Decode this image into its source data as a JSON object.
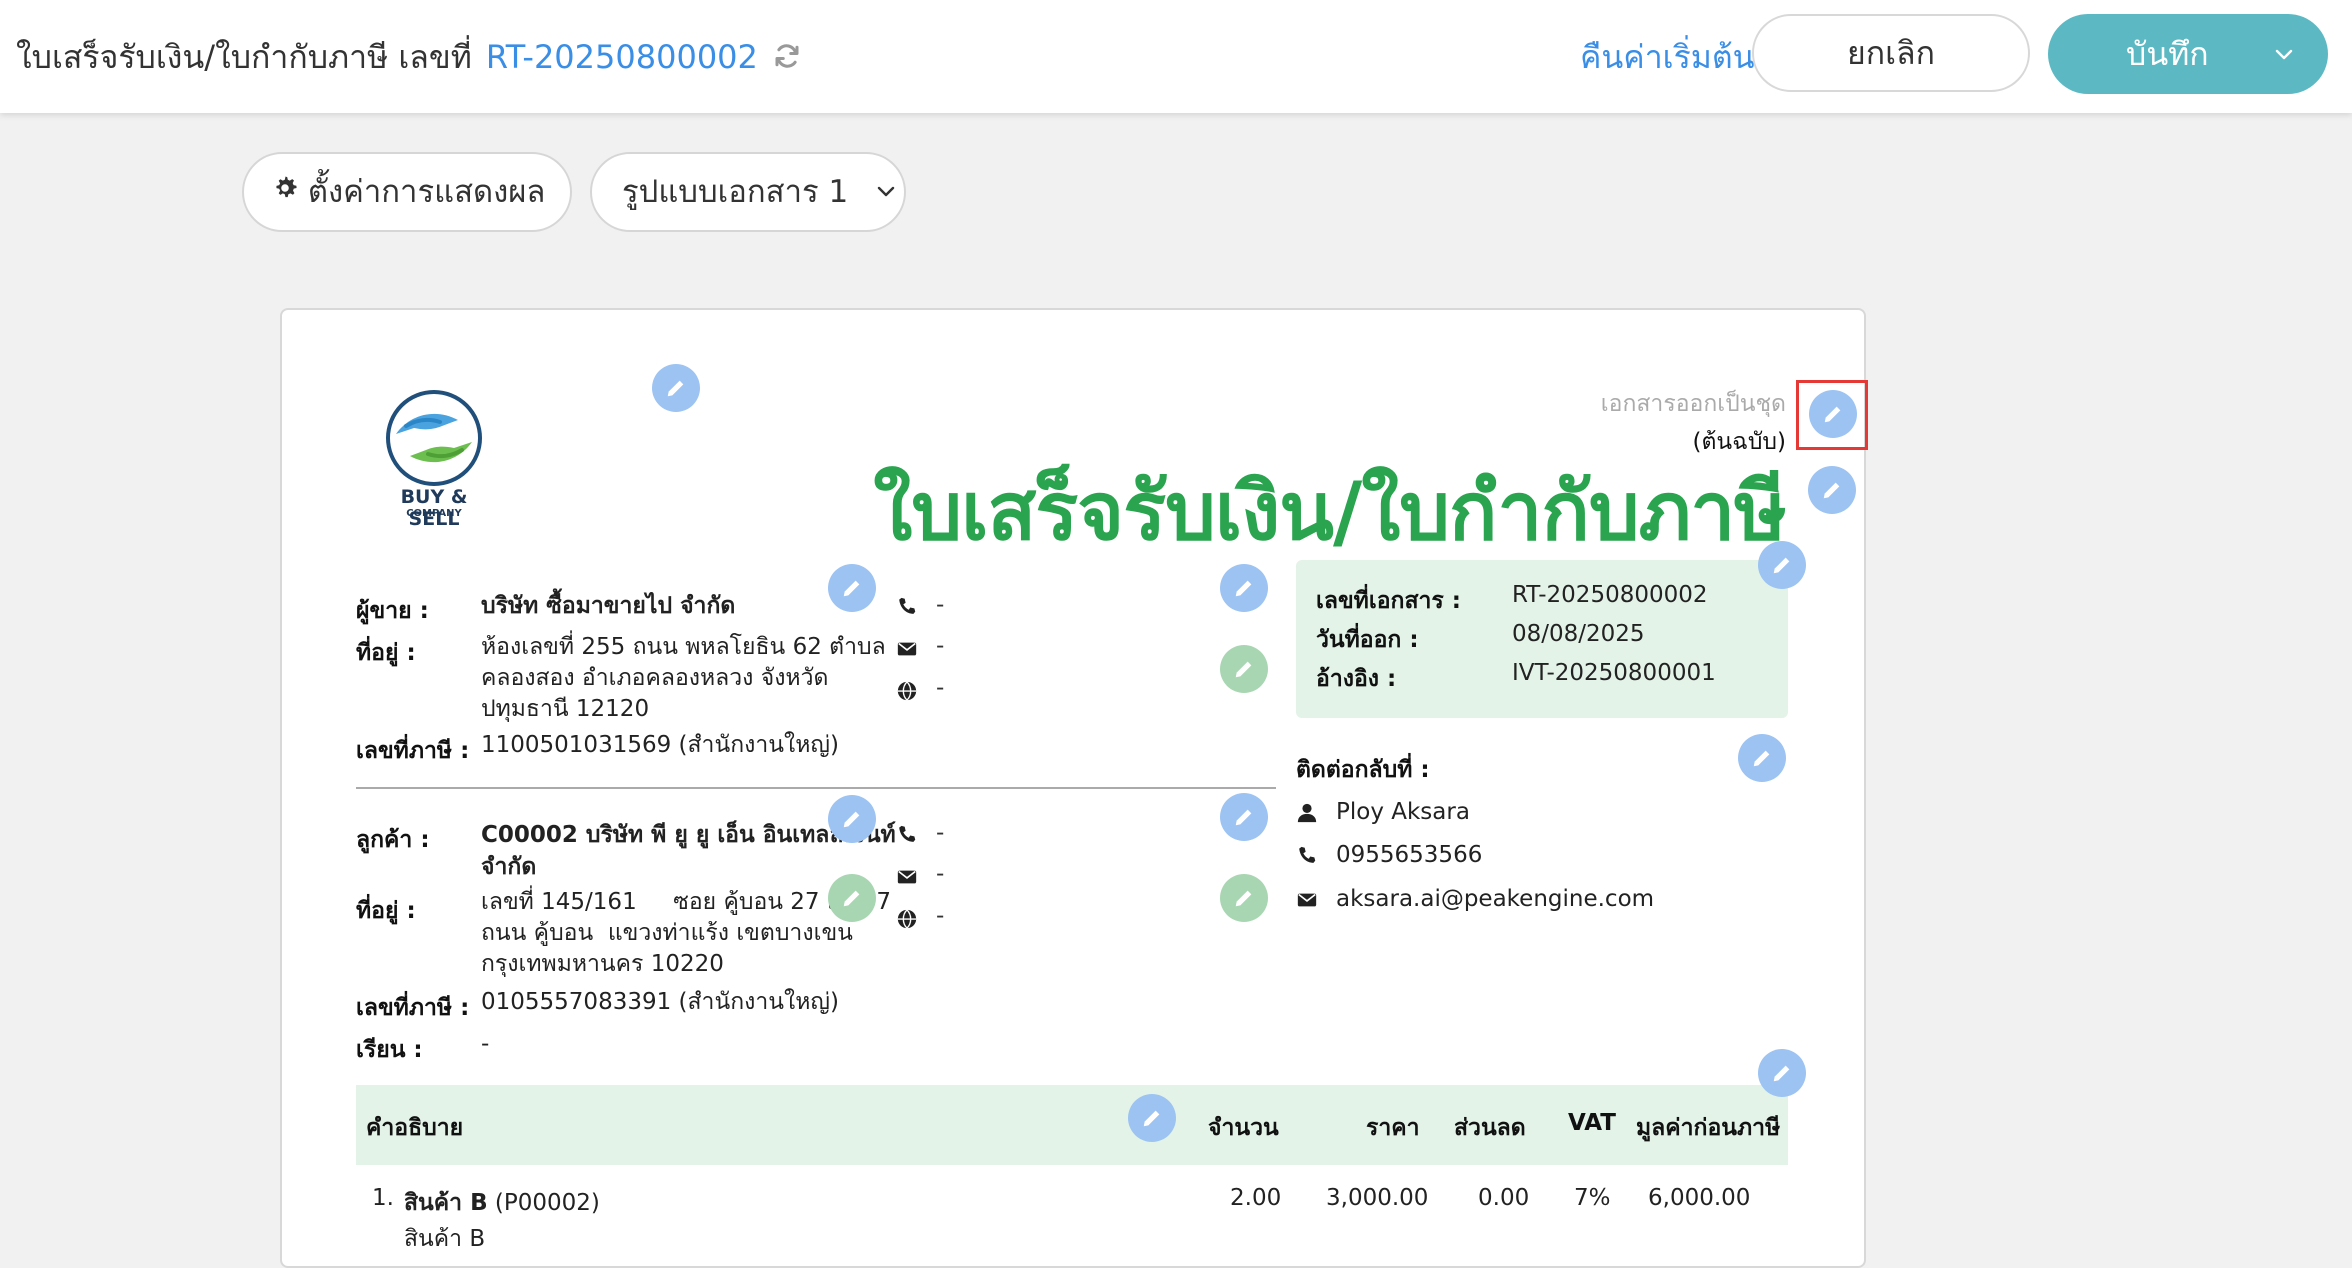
{
  "header": {
    "title": "ใบเสร็จรับเงิน/ใบกำกับภาษี เลขที่",
    "doc_no": "RT-20250800002",
    "reset_label": "คืนค่าเริ่มต้น",
    "cancel_label": "ยกเลิก",
    "save_label": "บันทึก"
  },
  "toolbar": {
    "settings_label": "ตั้งค่าการแสดงผล",
    "format_label": "รูปแบบเอกสาร 1"
  },
  "document": {
    "logo_text": "BUY & SELL",
    "logo_sub": "COMPANY",
    "copy_note": "เอกสารออกเป็นชุด",
    "copy_type": "(ต้นฉบับ)",
    "title": "ใบเสร็จรับเงิน/ใบกำกับภาษี",
    "seller": {
      "label": "ผู้ขาย :",
      "name": "บริษัท ซื้อมาขายไป จำกัด",
      "address_label": "ที่อยู่ :",
      "address_lines": [
        "ห้องเลขที่ 255 ถนน พหลโยธิน 62 ตำบล",
        "คลองสอง อำเภอคลองหลวง จังหวัด",
        "ปทุมธานี 12120"
      ],
      "tax_label": "เลขที่ภาษี :",
      "tax_id": "1100501031569 (สำนักงานใหญ่)",
      "phone": "-",
      "email": "-",
      "web": "-"
    },
    "customer": {
      "label": "ลูกค้า :",
      "name_lines": [
        "C00002 บริษัท พี ยู ยู เอ็น อินเทลลิเจนท์",
        "จำกัด"
      ],
      "address_label": "ที่อยู่ :",
      "address_lines": [
        "เลขที่ 145/161     ซอย คู้บอน 27 แยก 7",
        "ถนน คู้บอน  แขวงท่าแร้ง เขตบางเขน",
        "กรุงเทพมหานคร 10220"
      ],
      "tax_label": "เลขที่ภาษี :",
      "tax_id": "0105557083391 (สำนักงานใหญ่)",
      "attn_label": "เรียน :",
      "attn": "-",
      "phone": "-",
      "email": "-",
      "web": "-"
    },
    "info": {
      "docno_label": "เลขที่เอกสาร :",
      "docno": "RT-20250800002",
      "date_label": "วันที่ออก :",
      "date": "08/08/2025",
      "ref_label": "อ้างอิง :",
      "ref": "IVT-20250800001"
    },
    "contact": {
      "label": "ติดต่อกลับที่ :",
      "name": "Ploy Aksara",
      "phone": "0955653566",
      "email": "aksara.ai@peakengine.com"
    },
    "table": {
      "headers": {
        "desc": "คำอธิบาย",
        "qty": "จำนวน",
        "price": "ราคา",
        "discount": "ส่วนลด",
        "vat": "VAT",
        "amount": "มูลค่าก่อนภาษี"
      },
      "rows": [
        {
          "no": "1.",
          "name": "สินค้า B",
          "code": "(P00002)",
          "sub": "สินค้า B",
          "qty": "2.00",
          "price": "3,000.00",
          "discount": "0.00",
          "vat": "7%",
          "amount": "6,000.00"
        }
      ]
    }
  },
  "colors": {
    "accent": "#3a8ee6",
    "save_button": "#5cb9c4",
    "title_green": "#2aa44f",
    "edit_blue": "#9cc3f2",
    "edit_green": "#a9d6b2",
    "highlight": "#e53935"
  },
  "icons": [
    "refresh-icon",
    "chevron-down-icon",
    "gear-icon",
    "pencil-icon",
    "phone-icon",
    "mail-icon",
    "globe-icon",
    "person-icon"
  ]
}
